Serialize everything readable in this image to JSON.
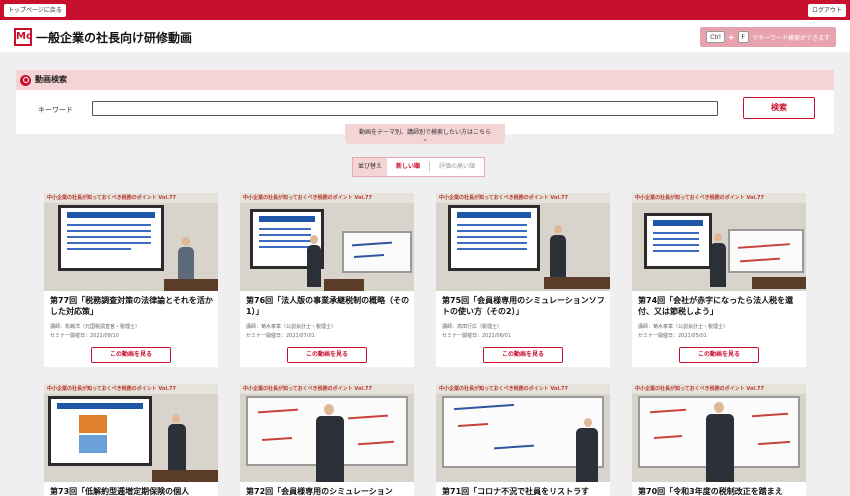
{
  "topbar": {
    "back_to_top": "トップページに戻る",
    "logout": "ログアウト"
  },
  "header": {
    "logo": "Mc",
    "site_title": "一般企業の社長向け研修動画",
    "kbd_key1": "Ctrl",
    "kbd_plus": "+",
    "kbd_key2": "F",
    "kbd_hint": "でキーワード検索ができます"
  },
  "search": {
    "heading": "動画検索",
    "keyword_label": "キーワード",
    "keyword_value": "",
    "button": "検索",
    "theme_toggle": "動画をテーマ別、講師別で検索したい方はこちら",
    "theme_toggle_icon": "chevron-down-icon"
  },
  "sort": {
    "label": "並び替え",
    "options": [
      "新しい順",
      "評価の高い順"
    ],
    "selected": "新しい順"
  },
  "banner_text": "中小企業の社長が知っておくべき税務のポイント Vol.77",
  "cards": [
    {
      "title": "第77回「税務調査対策の法律論とそれを活かした対応策」",
      "speaker": "講師：松嶋洋（元国税調査官・税理士）",
      "date": "セミナー開催日：2021/08/10",
      "button": "この動画を見る"
    },
    {
      "title": "第76回「法人版の事業承継税制の概略（その1）」",
      "speaker": "講師：菊水孝章（公認会計士・税理士）",
      "date": "セミナー開催日：2021/07/01",
      "button": "この動画を見る"
    },
    {
      "title": "第75回「会員様専用のシミュレーションソフトの使い方（その2）」",
      "speaker": "講師：高田行広（税理士）",
      "date": "セミナー開催日：2021/06/01",
      "button": "この動画を見る"
    },
    {
      "title": "第74回「会社が赤字になったら法人税を還付、又は節税しよう」",
      "speaker": "講師：菊水孝章（公認会計士・税理士）",
      "date": "セミナー開催日：2021/05/01",
      "button": "この動画を見る"
    },
    {
      "title": "第73回「低解約型逓増定期保険の個人",
      "speaker": "",
      "date": "",
      "button": ""
    },
    {
      "title": "第72回「会員様専用のシミュレーション",
      "speaker": "",
      "date": "",
      "button": ""
    },
    {
      "title": "第71回「コロナ不況で社員をリストラす",
      "speaker": "",
      "date": "",
      "button": ""
    },
    {
      "title": "第70回「令和3年度の税制改正を踏まえ",
      "speaker": "",
      "date": "",
      "button": ""
    }
  ]
}
